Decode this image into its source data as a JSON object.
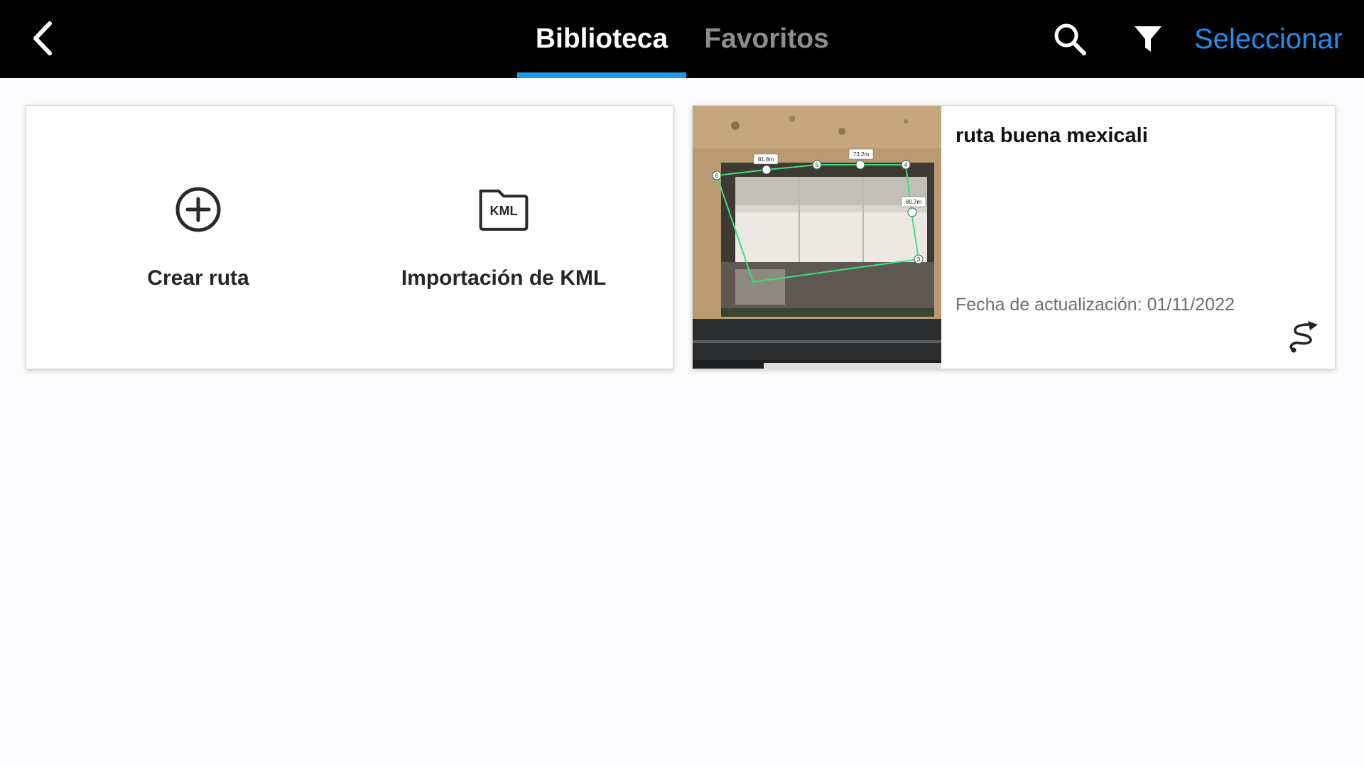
{
  "header": {
    "tabs": [
      {
        "label": "Biblioteca",
        "active": true
      },
      {
        "label": "Favoritos",
        "active": false
      }
    ],
    "select_label": "Seleccionar",
    "icons": [
      "chevron-left-icon",
      "search-icon",
      "filter-icon"
    ],
    "accent_color": "#1a9bf0",
    "link_color": "#1e8ff0"
  },
  "actions": {
    "create_route": {
      "label": "Crear ruta",
      "icon": "plus-circle-icon"
    },
    "import_kml": {
      "label": "Importación de KML",
      "icon": "kml-file-icon",
      "icon_text": "KML"
    }
  },
  "routes": [
    {
      "title": "ruta buena mexicali",
      "updated": "Fecha de actualización: 01/11/2022",
      "thumbnail": "satellite-map-thumbnail",
      "distance_labels": [
        "81.8m",
        "73.2m",
        "80.7m"
      ],
      "waypoint_labels": [
        "6",
        "5",
        "4",
        "3"
      ],
      "type_icon": "route-path-icon"
    }
  ]
}
